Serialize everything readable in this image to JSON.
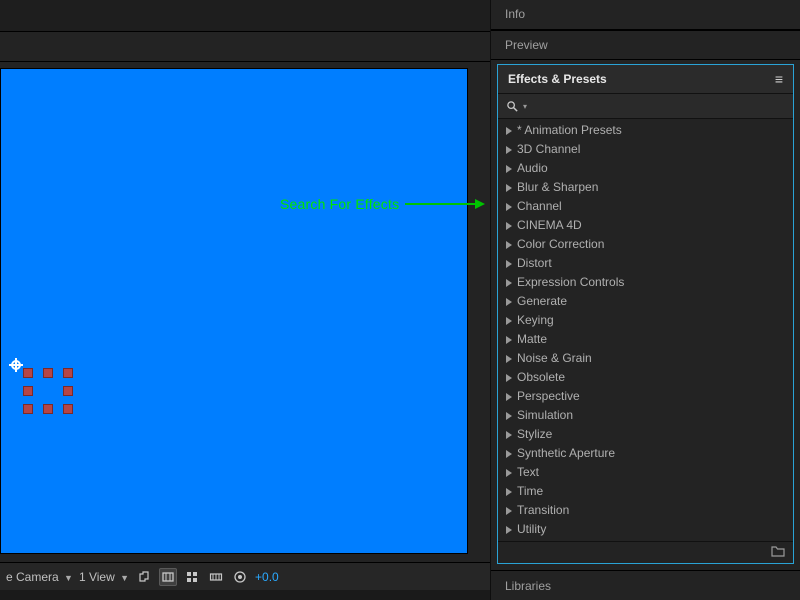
{
  "annotation": {
    "label": "Search For Effects"
  },
  "panels": {
    "info": "Info",
    "preview": "Preview",
    "libraries": "Libraries"
  },
  "effects": {
    "title": "Effects & Presets",
    "search_placeholder": "",
    "categories": [
      "* Animation Presets",
      "3D Channel",
      "Audio",
      "Blur & Sharpen",
      "Channel",
      "CINEMA 4D",
      "Color Correction",
      "Distort",
      "Expression Controls",
      "Generate",
      "Keying",
      "Matte",
      "Noise & Grain",
      "Obsolete",
      "Perspective",
      "Simulation",
      "Stylize",
      "Synthetic Aperture",
      "Text",
      "Time",
      "Transition",
      "Utility"
    ]
  },
  "toolbar": {
    "camera": "e Camera",
    "view": "1 View",
    "exposure": "+0.0"
  },
  "colors": {
    "canvas": "#007eff",
    "selected_handle": "#b54545",
    "panel_accent": "#2aa3d6",
    "annotation": "#00e600"
  }
}
